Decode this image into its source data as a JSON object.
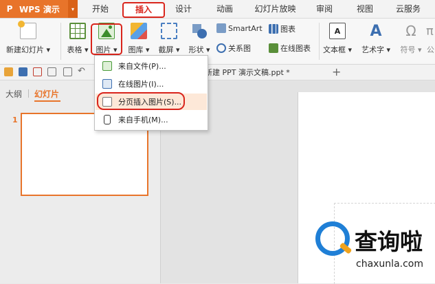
{
  "app": {
    "name": "WPS 演示",
    "logo_letter": "P"
  },
  "menu_tabs": [
    "开始",
    "插入",
    "设计",
    "动画",
    "幻灯片放映",
    "审阅",
    "视图",
    "云服务"
  ],
  "ribbon": {
    "new_slide": "新建幻灯片 ▾",
    "table": "表格 ▾",
    "picture": "图片 ▾",
    "gallery": "图库 ▾",
    "screenshot": "截屏 ▾",
    "shapes": "形状 ▾",
    "smartart": "SmartArt",
    "chart": "图表",
    "relation": "关系图",
    "online_chart": "在线图表",
    "textbox": "文本框 ▾",
    "wordart": "艺术字 ▾",
    "symbol": "符号 ▾",
    "formula": "公"
  },
  "document_tab": "新建 PPT 演示文稿.ppt *",
  "plus": "+",
  "left_panel": {
    "outline_tab": "大纲",
    "slides_tab": "幻灯片",
    "slide_number": "1"
  },
  "dropdown": {
    "items": [
      "来自文件(P)...",
      "在线图片(I)...",
      "分页插入图片(S)...",
      "来自手机(M)..."
    ]
  },
  "watermark": {
    "text": "查询啦",
    "url": "chaxunla.com"
  },
  "colors": {
    "accent": "#e8742a",
    "highlight": "#d9241b",
    "watermark_blue": "#1f7fd6"
  }
}
